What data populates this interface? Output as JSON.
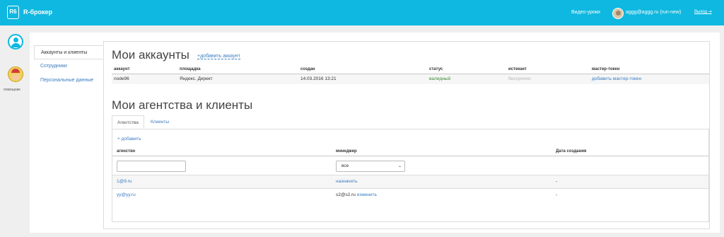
{
  "topbar": {
    "logo": "R6",
    "brand": "R-брокер",
    "video_link": "Видео-уроки",
    "user": "aggg@aggg.ru (run-new)",
    "logout": "Выход"
  },
  "rail": {
    "help_label": "помощник"
  },
  "sidebar": {
    "items": [
      {
        "label": "Аккаунты и клиенты",
        "active": true
      },
      {
        "label": "Сотрудники",
        "active": false
      },
      {
        "label": "Персональные данные",
        "active": false
      }
    ]
  },
  "accounts": {
    "title": "Мои аккаунты",
    "add_label": "+добавить аккаунт",
    "columns": [
      "аккаунт",
      "площадка",
      "создан",
      "статус",
      "истекает",
      "мастер-токен"
    ],
    "rows": [
      {
        "account": "node96",
        "platform": "Яндекс. Директ",
        "created": "14.03.2016 13:21",
        "status": "валидный",
        "expires": "бессрочно",
        "token": "добавить мастер-токен"
      }
    ]
  },
  "agencies": {
    "title": "Мои агентства и клиенты",
    "tabs": [
      "Агентства",
      "Клиенты"
    ],
    "active_tab": "Агентства",
    "add_label": "+ добавить",
    "columns": [
      "агенство",
      "менеджер",
      "Дата создания"
    ],
    "filter": {
      "agency_value": "",
      "manager_value": "все"
    },
    "rows": [
      {
        "agency": "1@9.ru",
        "manager": "",
        "manager_link": "назначить",
        "date": "-"
      },
      {
        "agency": "yy@yy.ru",
        "manager": "s2@s2.ru",
        "manager_link": "изменить",
        "date": "-"
      }
    ]
  },
  "colors": {
    "topbar": "#0eb8e0",
    "link": "#3a7bbf",
    "valid": "#3c8b33"
  }
}
